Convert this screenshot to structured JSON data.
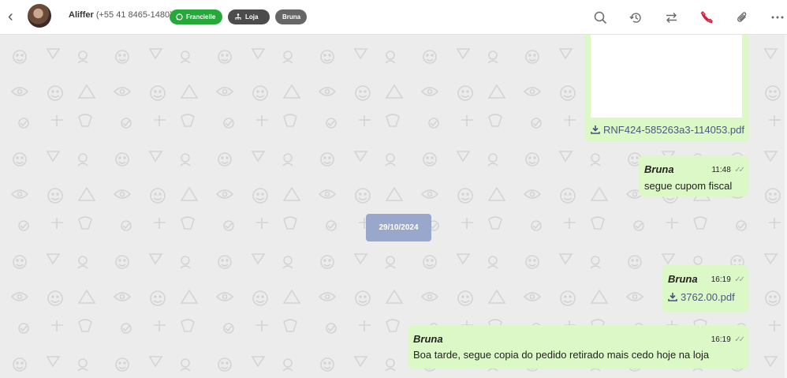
{
  "header": {
    "back_label": "‹",
    "contact_name": "Aliffer",
    "contact_phone": "(+55 41 8465-1480)",
    "tags": [
      {
        "label": "Francielle",
        "icon": "whatsapp-icon",
        "color": "#27a83a"
      },
      {
        "label": "Loja",
        "icon": "sitemap-icon",
        "color": "#4c4c4c"
      },
      {
        "label": "Bruna",
        "color": "#666666"
      }
    ],
    "tools": [
      "search-icon",
      "history-icon",
      "transfer-icon",
      "hangup-icon",
      "attachment-icon",
      "more-icon"
    ]
  },
  "chat": {
    "background": "#ececec",
    "bubble_color": "#dcf8c6",
    "date_separator": "29/10/2024",
    "messages": [
      {
        "type": "file",
        "file_name": "RNF424-585263a3-114053.pdf"
      },
      {
        "sender": "Bruna",
        "time": "11:48",
        "text": "segue cupom fiscal"
      },
      {
        "sender": "Bruna",
        "time": "16:19",
        "type": "file",
        "file_name": "3762.00.pdf"
      },
      {
        "sender": "Bruna",
        "time": "16:19",
        "text": "Boa tarde, segue copia do pedido retirado mais cedo hoje na loja"
      }
    ]
  }
}
